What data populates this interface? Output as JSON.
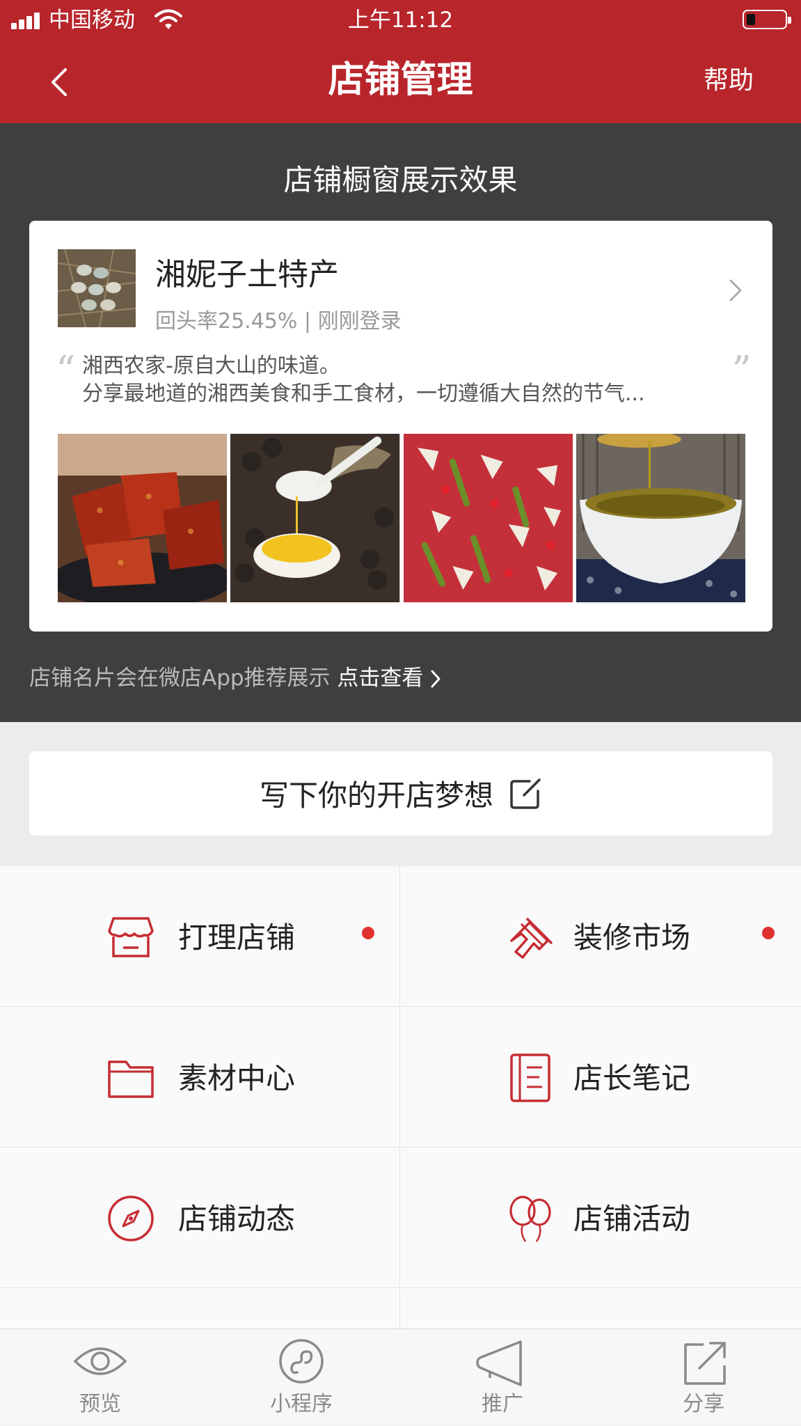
{
  "status_bar": {
    "carrier": "中国移动",
    "time": "上午11:12",
    "battery_level": 0.2
  },
  "nav": {
    "title": "店铺管理",
    "help_label": "帮助",
    "back_icon": "chevron-left-icon"
  },
  "showcase": {
    "heading": "店铺橱窗展示效果",
    "shop": {
      "name": "湘妮子土特产",
      "meta": "回头率25.45% | 刚刚登录",
      "quote_open": "“",
      "quote_close": "”",
      "description_line1": "湘西农家-原自大山的味道。",
      "description_line2": "分享最地道的湘西美食和手工食材，一切遵循大自然的节气..."
    },
    "tip_text": "店铺名片会在微店App推荐展示",
    "tip_link": "点击查看"
  },
  "dream_button": {
    "label": "写下你的开店梦想",
    "icon": "edit-icon"
  },
  "menu": [
    {
      "label": "打理店铺",
      "icon": "store-icon",
      "badge": true
    },
    {
      "label": "装修市场",
      "icon": "brush-icon",
      "badge": true
    },
    {
      "label": "素材中心",
      "icon": "folder-icon",
      "badge": false
    },
    {
      "label": "店长笔记",
      "icon": "notebook-icon",
      "badge": false
    },
    {
      "label": "店铺动态",
      "icon": "compass-icon",
      "badge": false
    },
    {
      "label": "店铺活动",
      "icon": "balloon-icon",
      "badge": false
    }
  ],
  "tabbar": [
    {
      "label": "预览",
      "icon": "eye-icon"
    },
    {
      "label": "小程序",
      "icon": "mini-program-icon"
    },
    {
      "label": "推广",
      "icon": "megaphone-icon"
    },
    {
      "label": "分享",
      "icon": "share-icon"
    }
  ],
  "colors": {
    "brand_red": "#b8252b",
    "dark_panel": "#3f3f3f",
    "badge_red": "#e03030"
  }
}
